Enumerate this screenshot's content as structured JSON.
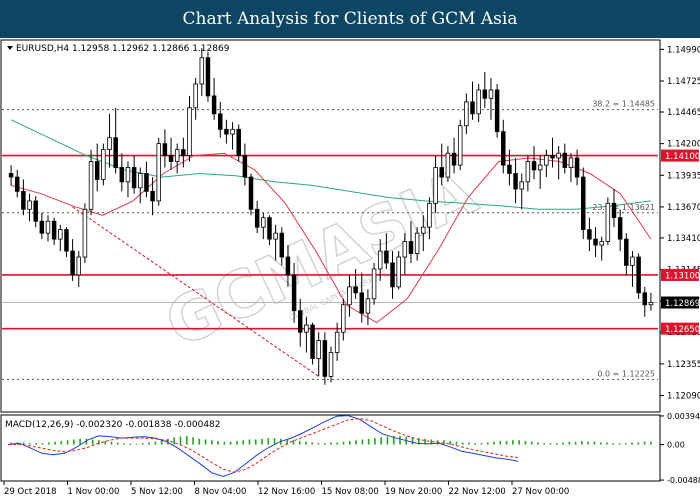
{
  "header": {
    "title": "Chart Analysis for Clients of GCM Asia"
  },
  "chart_data": {
    "type": "candlestick",
    "symbol_line": "EURUSD,H4  1.12958 1.12962 1.12866 1.12869",
    "price_axis": {
      "ylim": [
        1.1196,
        1.1506
      ],
      "tick_labels": [
        "1.14990",
        "1.14725",
        "1.14465",
        "1.14200",
        "1.13935",
        "1.13670",
        "1.13410",
        "1.13145",
        "1.12880",
        "1.12620",
        "1.12355",
        "1.12090"
      ],
      "tick_values": [
        1.1499,
        1.14725,
        1.14465,
        1.142,
        1.13935,
        1.1367,
        1.1341,
        1.13145,
        1.1288,
        1.1262,
        1.12355,
        1.1209
      ]
    },
    "x_axis_labels": [
      "29 Oct 2018",
      "1 Nov 00:00",
      "5 Nov 12:00",
      "8 Nov 04:00",
      "12 Nov 16:00",
      "15 Nov 08:00",
      "19 Nov 20:00",
      "22 Nov 12:00",
      "27 Nov 00:00"
    ],
    "current_price": {
      "label": "1.12869",
      "value": 1.12869
    },
    "horizontal_lines": [
      {
        "label": "1.14100",
        "value": 1.141,
        "color": "#d9142b"
      },
      {
        "label": "1.13100",
        "value": 1.131,
        "color": "#d9142b"
      },
      {
        "label": "1.12650",
        "value": 1.1265,
        "color": "#d9142b"
      }
    ],
    "fibonacci_levels": [
      {
        "label": "38.2 = 1.14485",
        "value": 1.14485
      },
      {
        "label": "23.6 = 1.13621",
        "value": 1.13621
      },
      {
        "label": "0.0 = 1.12225",
        "value": 1.12225
      }
    ],
    "trendline": {
      "color": "#d9142b",
      "style": "dashed",
      "from_value": 1.1367,
      "to_value": 1.1225
    },
    "candles": [
      [
        1.1395,
        1.1402,
        1.1385,
        1.1392
      ],
      [
        1.1392,
        1.1398,
        1.1375,
        1.138
      ],
      [
        1.138,
        1.139,
        1.136,
        1.1365
      ],
      [
        1.1365,
        1.1378,
        1.1355,
        1.1372
      ],
      [
        1.1372,
        1.1376,
        1.135,
        1.1355
      ],
      [
        1.1355,
        1.1362,
        1.134,
        1.1345
      ],
      [
        1.1345,
        1.136,
        1.1338,
        1.1355
      ],
      [
        1.1355,
        1.1358,
        1.1335,
        1.134
      ],
      [
        1.134,
        1.1352,
        1.133,
        1.1348
      ],
      [
        1.1348,
        1.135,
        1.1325,
        1.133
      ],
      [
        1.133,
        1.134,
        1.1305,
        1.131
      ],
      [
        1.131,
        1.133,
        1.13,
        1.1325
      ],
      [
        1.1325,
        1.137,
        1.132,
        1.1365
      ],
      [
        1.1365,
        1.1415,
        1.136,
        1.1405
      ],
      [
        1.1405,
        1.142,
        1.138,
        1.139
      ],
      [
        1.139,
        1.142,
        1.1385,
        1.1415
      ],
      [
        1.1415,
        1.1445,
        1.14,
        1.1425
      ],
      [
        1.1425,
        1.145,
        1.1395,
        1.14
      ],
      [
        1.14,
        1.1412,
        1.138,
        1.1388
      ],
      [
        1.1388,
        1.1405,
        1.1375,
        1.14
      ],
      [
        1.14,
        1.141,
        1.1378,
        1.1383
      ],
      [
        1.1383,
        1.14,
        1.137,
        1.1395
      ],
      [
        1.1395,
        1.1405,
        1.1375,
        1.138
      ],
      [
        1.138,
        1.1392,
        1.136,
        1.1372
      ],
      [
        1.1372,
        1.1425,
        1.1368,
        1.142
      ],
      [
        1.142,
        1.1432,
        1.14,
        1.141
      ],
      [
        1.141,
        1.1425,
        1.1398,
        1.1405
      ],
      [
        1.1405,
        1.142,
        1.1395,
        1.1415
      ],
      [
        1.1415,
        1.1425,
        1.14,
        1.141
      ],
      [
        1.141,
        1.146,
        1.1405,
        1.145
      ],
      [
        1.145,
        1.1475,
        1.144,
        1.147
      ],
      [
        1.147,
        1.15,
        1.146,
        1.1492
      ],
      [
        1.1492,
        1.1497,
        1.1455,
        1.146
      ],
      [
        1.146,
        1.1475,
        1.144,
        1.1445
      ],
      [
        1.1445,
        1.1455,
        1.1425,
        1.1432
      ],
      [
        1.1432,
        1.144,
        1.142,
        1.1428
      ],
      [
        1.1428,
        1.1438,
        1.1415,
        1.1432
      ],
      [
        1.1432,
        1.1436,
        1.1405,
        1.141
      ],
      [
        1.141,
        1.142,
        1.1385,
        1.1392
      ],
      [
        1.1392,
        1.1395,
        1.136,
        1.1365
      ],
      [
        1.1365,
        1.1372,
        1.1345,
        1.135
      ],
      [
        1.135,
        1.1362,
        1.134,
        1.1358
      ],
      [
        1.1358,
        1.136,
        1.1335,
        1.134
      ],
      [
        1.134,
        1.1352,
        1.1322,
        1.1345
      ],
      [
        1.1345,
        1.135,
        1.1318,
        1.1325
      ],
      [
        1.1325,
        1.1335,
        1.13,
        1.131
      ],
      [
        1.131,
        1.132,
        1.127,
        1.128
      ],
      [
        1.128,
        1.129,
        1.125,
        1.1262
      ],
      [
        1.1262,
        1.1275,
        1.1245,
        1.1268
      ],
      [
        1.1268,
        1.127,
        1.1235,
        1.124
      ],
      [
        1.124,
        1.1262,
        1.1225,
        1.1255
      ],
      [
        1.1255,
        1.1262,
        1.1218,
        1.1225
      ],
      [
        1.1225,
        1.125,
        1.122,
        1.1245
      ],
      [
        1.1245,
        1.127,
        1.1238,
        1.1262
      ],
      [
        1.1262,
        1.129,
        1.1255,
        1.1285
      ],
      [
        1.1285,
        1.131,
        1.1275,
        1.13
      ],
      [
        1.13,
        1.1315,
        1.129,
        1.1295
      ],
      [
        1.1295,
        1.1312,
        1.127,
        1.1278
      ],
      [
        1.1278,
        1.1298,
        1.1268,
        1.129
      ],
      [
        1.129,
        1.132,
        1.1285,
        1.1315
      ],
      [
        1.1315,
        1.134,
        1.1305,
        1.133
      ],
      [
        1.133,
        1.1345,
        1.1315,
        1.132
      ],
      [
        1.132,
        1.133,
        1.129,
        1.13
      ],
      [
        1.13,
        1.133,
        1.1298,
        1.1325
      ],
      [
        1.1325,
        1.1345,
        1.131,
        1.1338
      ],
      [
        1.1338,
        1.1355,
        1.132,
        1.1328
      ],
      [
        1.1328,
        1.135,
        1.1322,
        1.1345
      ],
      [
        1.1345,
        1.136,
        1.133,
        1.135
      ],
      [
        1.135,
        1.1375,
        1.134,
        1.137
      ],
      [
        1.137,
        1.141,
        1.1362,
        1.14
      ],
      [
        1.14,
        1.142,
        1.1385,
        1.1392
      ],
      [
        1.1392,
        1.1418,
        1.1388,
        1.1412
      ],
      [
        1.1412,
        1.1425,
        1.1395,
        1.1402
      ],
      [
        1.1402,
        1.144,
        1.1398,
        1.1435
      ],
      [
        1.1435,
        1.1462,
        1.1428,
        1.1455
      ],
      [
        1.1455,
        1.1472,
        1.144,
        1.1445
      ],
      [
        1.1445,
        1.147,
        1.1438,
        1.1465
      ],
      [
        1.1465,
        1.148,
        1.145,
        1.1458
      ],
      [
        1.1458,
        1.1475,
        1.144,
        1.1465
      ],
      [
        1.1465,
        1.147,
        1.1425,
        1.143
      ],
      [
        1.143,
        1.144,
        1.1395,
        1.1402
      ],
      [
        1.1402,
        1.1415,
        1.1385,
        1.1395
      ],
      [
        1.1395,
        1.1408,
        1.137,
        1.1382
      ],
      [
        1.1382,
        1.1395,
        1.1365,
        1.1388
      ],
      [
        1.1388,
        1.141,
        1.138,
        1.1405
      ],
      [
        1.1405,
        1.1418,
        1.139,
        1.1398
      ],
      [
        1.1398,
        1.141,
        1.1382,
        1.1402
      ],
      [
        1.1402,
        1.1415,
        1.1392,
        1.141
      ],
      [
        1.141,
        1.1425,
        1.14,
        1.1408
      ],
      [
        1.1408,
        1.1418,
        1.139,
        1.1412
      ],
      [
        1.1412,
        1.142,
        1.1395,
        1.14
      ],
      [
        1.14,
        1.1412,
        1.1388,
        1.1408
      ],
      [
        1.1408,
        1.1415,
        1.1385,
        1.1392
      ],
      [
        1.1392,
        1.14,
        1.134,
        1.1348
      ],
      [
        1.1348,
        1.1358,
        1.133,
        1.134
      ],
      [
        1.134,
        1.135,
        1.1325,
        1.1335
      ],
      [
        1.1335,
        1.1342,
        1.1322,
        1.1338
      ],
      [
        1.1338,
        1.1375,
        1.1335,
        1.137
      ],
      [
        1.137,
        1.1382,
        1.135,
        1.1358
      ],
      [
        1.1358,
        1.1365,
        1.133,
        1.134
      ],
      [
        1.134,
        1.1345,
        1.131,
        1.1318
      ],
      [
        1.1318,
        1.133,
        1.13,
        1.1325
      ],
      [
        1.1325,
        1.1328,
        1.129,
        1.1295
      ],
      [
        1.1295,
        1.13,
        1.1275,
        1.1285
      ],
      [
        1.1285,
        1.1295,
        1.128,
        1.1287
      ]
    ],
    "ma_slow": {
      "color": "#2aa876",
      "values": [
        1.144,
        1.1425,
        1.141,
        1.1398,
        1.1392,
        1.1395,
        1.1393,
        1.1388,
        1.1385,
        1.138,
        1.1375,
        1.1372,
        1.137,
        1.1368,
        1.1365,
        1.1365,
        1.1368,
        1.1372
      ]
    },
    "ma_fast": {
      "color": "#e03a4f",
      "values": [
        1.1385,
        1.1378,
        1.1368,
        1.136,
        1.1372,
        1.1395,
        1.141,
        1.1412,
        1.1398,
        1.137,
        1.133,
        1.1285,
        1.127,
        1.129,
        1.133,
        1.1375,
        1.1405,
        1.1408,
        1.1405,
        1.1395,
        1.1378,
        1.134
      ]
    },
    "macd": {
      "label": "MACD(12,26,9) -0.002320 -0.001838 -0.000482",
      "ylim": [
        -0.00488,
        0.00394
      ],
      "tick_labels": [
        "0.003946",
        "0.00",
        "-0.004888"
      ],
      "tick_values": [
        0.003946,
        0.0,
        -0.004888
      ],
      "histogram_color": "#27a322",
      "main_color": "#1f3fd6",
      "signal_color": "#e02020",
      "main": [
        0.0,
        0.0002,
        -0.0005,
        -0.0012,
        -0.0014,
        -0.0012,
        -0.0004,
        0.0006,
        0.0012,
        0.0011,
        0.0009,
        0.001,
        0.0011,
        0.0009,
        0.0004,
        -0.0005,
        -0.0016,
        -0.0027,
        -0.0039,
        -0.0044,
        -0.0038,
        -0.0026,
        -0.0014,
        -0.0004,
        0.0004,
        0.0009,
        0.0016,
        0.0024,
        0.0032,
        0.0039,
        0.004,
        0.0035,
        0.0025,
        0.0015,
        0.001,
        0.0006,
        0.0002,
        0.0001,
        0.0002,
        -0.0003,
        -0.0009,
        -0.0012,
        -0.0015,
        -0.0018,
        -0.002,
        -0.0023
      ],
      "signal": [
        0.0,
        0.0,
        -0.0002,
        -0.0005,
        -0.0008,
        -0.001,
        -0.0008,
        -0.0004,
        0.0002,
        0.0006,
        0.0009,
        0.0009,
        0.0009,
        0.0008,
        0.0006,
        0.0001,
        -0.0006,
        -0.0015,
        -0.0025,
        -0.0034,
        -0.0038,
        -0.0034,
        -0.0025,
        -0.0014,
        -0.0004,
        0.0004,
        0.001,
        0.0016,
        0.0022,
        0.0028,
        0.0034,
        0.0036,
        0.0033,
        0.0026,
        0.0019,
        0.0013,
        0.0008,
        0.0005,
        0.0003,
        0.0001,
        -0.0003,
        -0.0007,
        -0.001,
        -0.0013,
        -0.0016,
        -0.0018
      ],
      "histogram": [
        0.0003,
        0.0003,
        0.0003,
        0.0002,
        0.0002,
        0.0002,
        0.0003,
        0.0004,
        0.0005,
        0.0006,
        0.0007,
        0.0008,
        0.0008,
        0.0007,
        0.0006,
        0.0005,
        0.0004,
        0.0003,
        0.0002,
        0.0001,
        0.0001,
        0.0002,
        0.0003,
        0.0004,
        0.0006,
        0.0008,
        0.001,
        0.0011,
        0.0012,
        0.001,
        0.0008,
        0.0007,
        0.0006,
        0.0005,
        0.0004,
        0.0004,
        0.0005,
        0.0006,
        0.0007,
        0.0007,
        0.0008,
        0.0009,
        0.0009,
        0.0008,
        0.0007,
        0.0006,
        0.0005,
        0.0004,
        0.0003,
        0.0002,
        0.0002,
        0.0003,
        0.0003,
        0.0004,
        0.0005,
        0.0006,
        0.0007,
        0.0008,
        0.0009,
        0.001,
        0.0011,
        0.0012,
        0.0012,
        0.0011,
        0.001,
        0.0009,
        0.0008,
        0.0007,
        0.0006,
        0.0006,
        0.0005,
        0.0004,
        0.0003,
        0.0003,
        0.0002,
        0.0002,
        0.0003,
        0.0004,
        0.0005,
        0.0005,
        0.0006,
        0.0006,
        0.0005,
        0.0004,
        0.0003,
        0.0002,
        0.0002,
        0.0002,
        0.0003,
        0.0004,
        0.0004,
        0.0005,
        0.0004,
        0.0004,
        0.0003,
        0.0003,
        0.0002,
        0.0002,
        0.0002,
        0.0003,
        0.0003,
        0.0004,
        0.0004
      ]
    }
  },
  "watermark": {
    "text": "GCMASIA",
    "subtext": "GLOBAL CAPITAL MARKETS"
  }
}
